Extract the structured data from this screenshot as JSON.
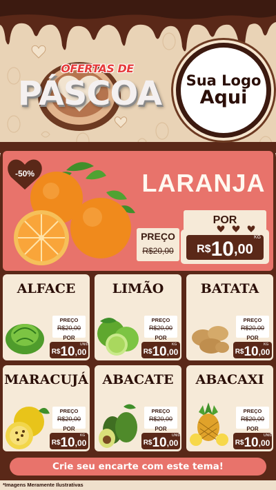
{
  "header": {
    "title_small": "OFERTAS DE",
    "title_big": "PÁSCOA",
    "logo_line1": "Sua Logo",
    "logo_line2": "Aqui"
  },
  "colors": {
    "chocolate_dark": "#3c1a10",
    "chocolate": "#5a2818",
    "salmon": "#e8736b",
    "cream": "#f6ead8",
    "beige": "#e9d3b6",
    "title_red": "#e63a3a"
  },
  "hero": {
    "name": "LARANJA",
    "discount": "-50%",
    "price_label": "PREÇO",
    "old_price": "R$20,00",
    "por_label": "POR",
    "currency": "R$",
    "price_int": "10",
    "price_dec": ",00",
    "unit": "KG",
    "icon": "orange-image"
  },
  "products": [
    {
      "name": "ALFACE",
      "price_label": "PREÇO",
      "old_price": "R$20,00",
      "por_label": "POR",
      "currency": "R$",
      "price_int": "10",
      "price_dec": ",00",
      "unit": "UNID",
      "icon": "lettuce-image"
    },
    {
      "name": "LIMÃO",
      "price_label": "PREÇO",
      "old_price": "R$20,00",
      "por_label": "POR",
      "currency": "R$",
      "price_int": "10",
      "price_dec": ",00",
      "unit": "KG",
      "icon": "lime-image"
    },
    {
      "name": "BATATA",
      "price_label": "PREÇO",
      "old_price": "R$20,00",
      "por_label": "POR",
      "currency": "R$",
      "price_int": "10",
      "price_dec": ",00",
      "unit": "KG",
      "icon": "potato-image"
    },
    {
      "name": "MARACUJÁ",
      "price_label": "PREÇO",
      "old_price": "R$20,00",
      "por_label": "POR",
      "currency": "R$",
      "price_int": "10",
      "price_dec": ",00",
      "unit": "KG",
      "icon": "passion-fruit-image"
    },
    {
      "name": "ABACATE",
      "price_label": "PREÇO",
      "old_price": "R$20,00",
      "por_label": "POR",
      "currency": "R$",
      "price_int": "10",
      "price_dec": ",00",
      "unit": "UNID",
      "icon": "avocado-image"
    },
    {
      "name": "ABACAXI",
      "price_label": "PREÇO",
      "old_price": "R$20,00",
      "por_label": "POR",
      "currency": "R$",
      "price_int": "10",
      "price_dec": ",00",
      "unit": "UNID",
      "icon": "pineapple-image"
    }
  ],
  "footer": {
    "cta": "Crie seu encarte com este tema!",
    "disclaimer": "*Imagens Meramente Ilustrativas"
  }
}
